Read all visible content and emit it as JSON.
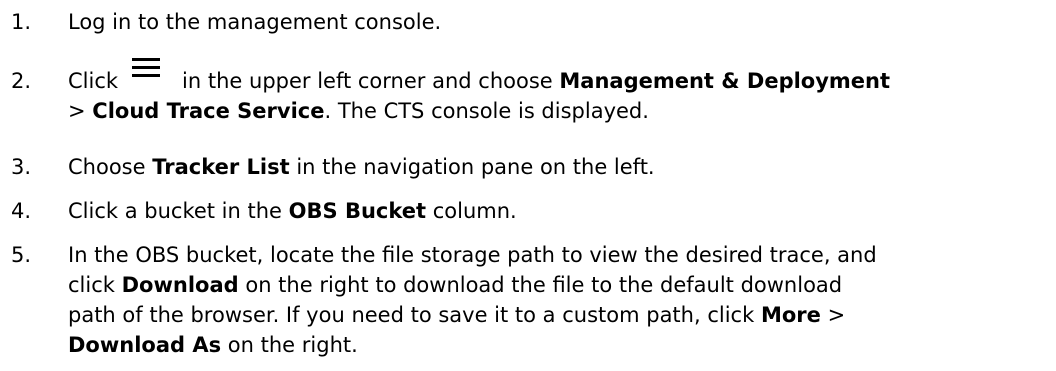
{
  "steps": [
    {
      "num": "1.",
      "text": "Log in to the management console."
    },
    {
      "num": "2.",
      "pre": "Click",
      "icon": "menu-icon",
      "mid": "in the upper left corner and choose",
      "b1": "Management & Deployment",
      "sep": ">",
      "b2": "Cloud Trace Service",
      "post": ". The CTS console is displayed."
    },
    {
      "num": "3.",
      "pre": "Choose",
      "b1": "Tracker List",
      "post": "in the navigation pane on the left."
    },
    {
      "num": "4.",
      "pre": "Click a bucket in the",
      "b1": "OBS Bucket",
      "post": "column."
    },
    {
      "num": "5.",
      "line1": "In the OBS bucket, locate the file storage path to view the desired trace, and",
      "line2_pre": "click",
      "line2_b": "Download",
      "line2_post": "on the right to download the file to the default download",
      "line3_pre": "path of the browser. If you need to save it to a custom path, click",
      "line3_b": "More",
      "line3_sep": ">",
      "line4_b": "Download As",
      "line4_post": "on the right."
    }
  ]
}
